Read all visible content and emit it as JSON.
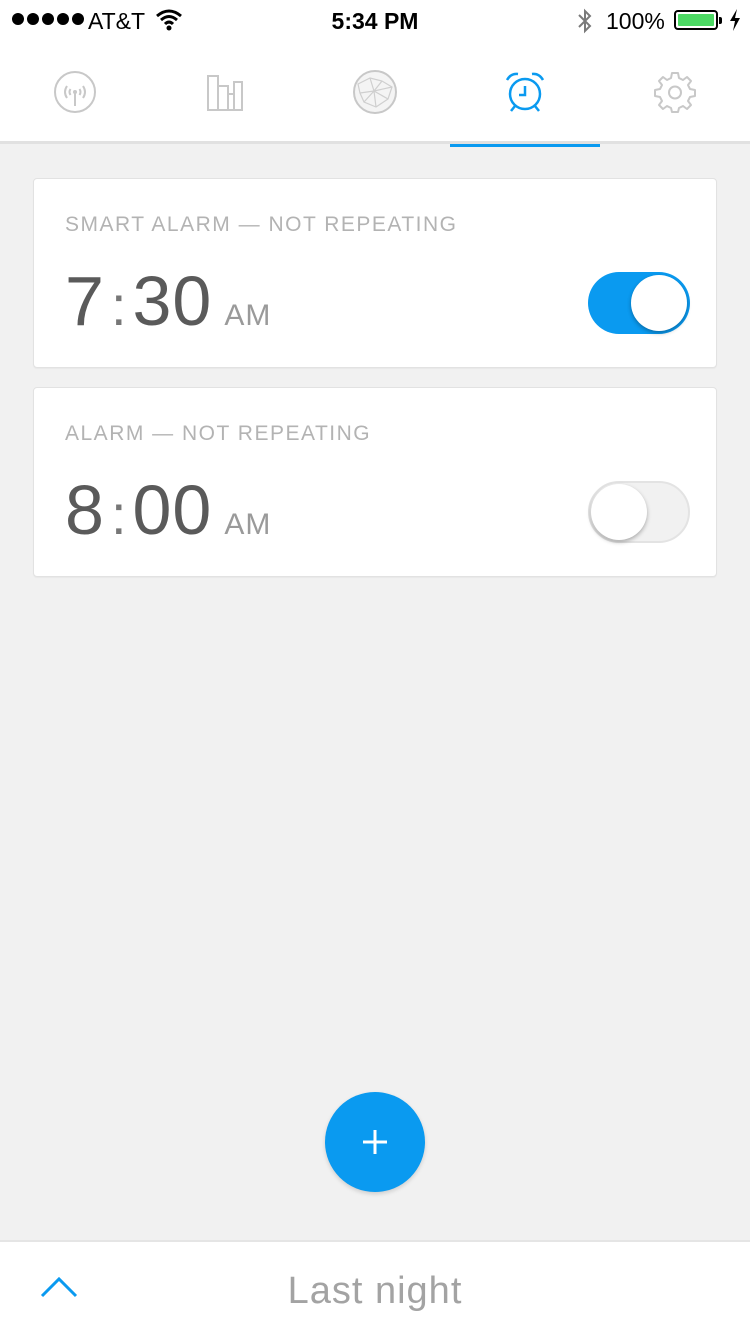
{
  "status_bar": {
    "carrier": "AT&T",
    "time": "5:34 PM",
    "battery_percent": "100%"
  },
  "nav": {
    "tabs": [
      {
        "icon": "signal-tower-icon",
        "active": false
      },
      {
        "icon": "bar-chart-icon",
        "active": false
      },
      {
        "icon": "globe-icon",
        "active": false
      },
      {
        "icon": "alarm-clock-icon",
        "active": true
      },
      {
        "icon": "gear-icon",
        "active": false
      }
    ],
    "accent_color": "#0a9af0"
  },
  "alarms": [
    {
      "label": "SMART ALARM — NOT REPEATING",
      "hour": "7",
      "minute": "30",
      "ampm": "AM",
      "enabled": true
    },
    {
      "label": "ALARM — NOT REPEATING",
      "hour": "8",
      "minute": "00",
      "ampm": "AM",
      "enabled": false
    }
  ],
  "add_button": {
    "icon": "plus-icon"
  },
  "bottom_bar": {
    "label": "Last night",
    "icon": "chevron-up-icon"
  }
}
